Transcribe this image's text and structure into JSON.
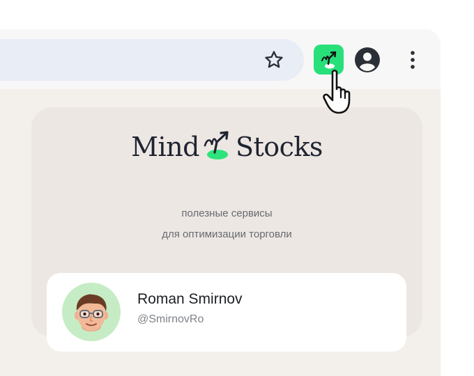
{
  "toolbar": {
    "icons": {
      "bookmark": "star-outline-icon",
      "extension": "mindstocks-extension-icon",
      "profile": "account-circle-icon",
      "menu": "three-dots-vertical-icon"
    },
    "extension_color": "#28e07a"
  },
  "panel": {
    "logo": {
      "left_text": "Mind",
      "right_text": "Stocks",
      "accent_color": "#2ee37c"
    },
    "tagline_line1": "полезные сервисы",
    "tagline_line2": "для оптимизации торговли",
    "user": {
      "name": "Roman Smirnov",
      "handle": "@SmirnovRo"
    }
  }
}
